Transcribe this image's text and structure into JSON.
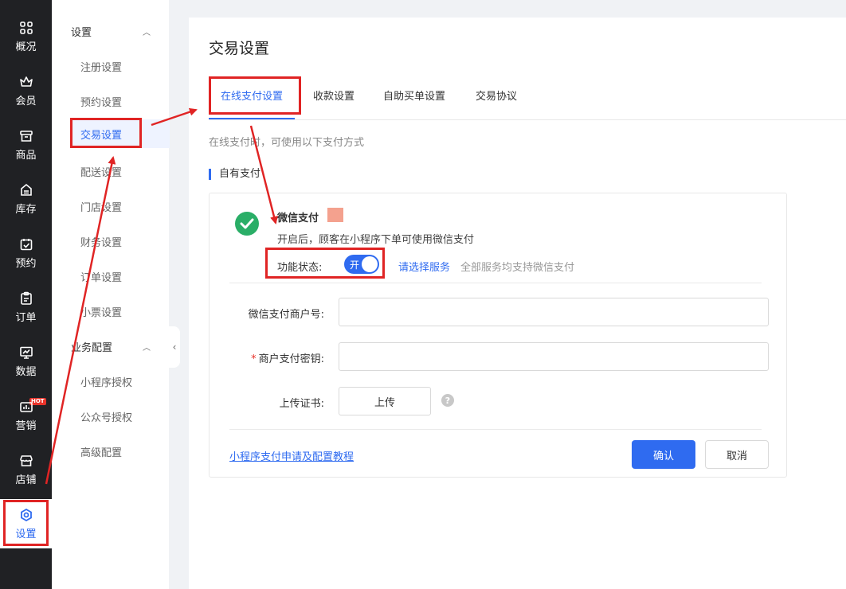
{
  "nav": {
    "items": [
      {
        "label": "概况",
        "icon": "grid-icon"
      },
      {
        "label": "会员",
        "icon": "crown-icon"
      },
      {
        "label": "商品",
        "icon": "box-icon"
      },
      {
        "label": "库存",
        "icon": "inventory-icon"
      },
      {
        "label": "预约",
        "icon": "calendar-check-icon"
      },
      {
        "label": "订单",
        "icon": "clipboard-icon"
      },
      {
        "label": "数据",
        "icon": "chart-icon"
      },
      {
        "label": "营销",
        "icon": "marketing-icon"
      },
      {
        "label": "店铺",
        "icon": "store-icon"
      },
      {
        "label": "设置",
        "icon": "settings-icon"
      }
    ],
    "hot_badge": "HOT",
    "active": "设置"
  },
  "submenu": {
    "group1": "设置",
    "group1_items": [
      "注册设置",
      "预约设置",
      "交易设置",
      "配送设置",
      "门店设置",
      "财务设置",
      "订单设置",
      "小票设置"
    ],
    "group2": "业务配置",
    "group2_items": [
      "小程序授权",
      "公众号授权",
      "高级配置"
    ],
    "active": "交易设置"
  },
  "main": {
    "title": "交易设置",
    "tabs": [
      "在线支付设置",
      "收款设置",
      "自助买单设置",
      "交易协议"
    ],
    "active_tab": "在线支付设置",
    "hint": "在线支付时，可使用以下支付方式",
    "section_title": "自有支付",
    "wechat": {
      "name": "微信支付",
      "desc": "开启后，顾客在小程序下单可使用微信支付",
      "status_label": "功能状态:",
      "toggle_label": "开",
      "toggle_on": true,
      "service_link": "请选择服务",
      "service_note": "全部服务均支持微信支付"
    },
    "form": {
      "merchant_id_label": "微信支付商户号:",
      "merchant_id_value": "",
      "secret_required_mark": "*",
      "secret_label": "商户支付密钥:",
      "secret_value": "",
      "cert_label": "上传证书:",
      "upload_button": "上传",
      "help_mark": "?"
    },
    "tutorial_link": "小程序支付申请及配置教程",
    "confirm_button": "确认",
    "cancel_button": "取消"
  },
  "colors": {
    "accent": "#2f6bf0",
    "nav_bg": "#202124",
    "annotation": "#e02424",
    "wechat_green": "#2aae67"
  }
}
